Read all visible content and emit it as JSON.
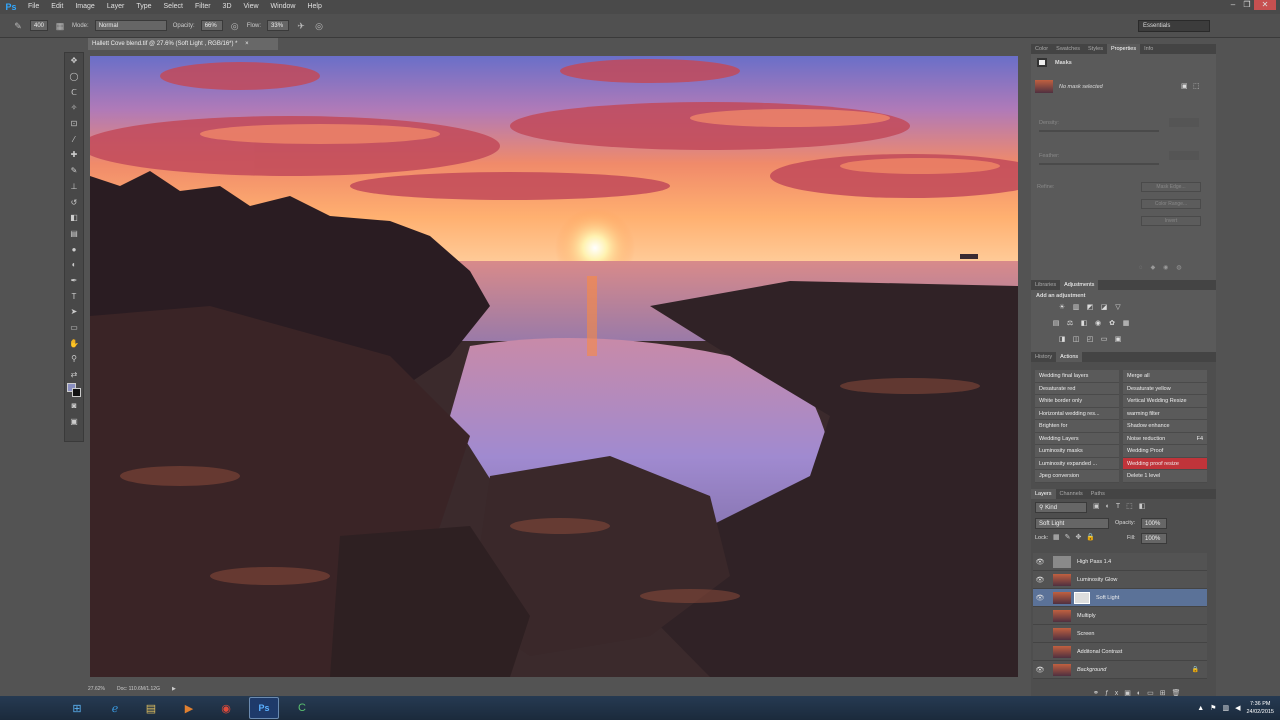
{
  "app": {
    "logo": "Ps"
  },
  "menu": [
    "File",
    "Edit",
    "Image",
    "Layer",
    "Type",
    "Select",
    "Filter",
    "3D",
    "View",
    "Window",
    "Help"
  ],
  "window_controls": {
    "minimize": "–",
    "maximize": "❐",
    "close": "✕"
  },
  "options": {
    "brush_size": "400",
    "mode_label": "Mode:",
    "mode_value": "Normal",
    "opacity_label": "Opacity:",
    "opacity_value": "66%",
    "flow_label": "Flow:",
    "flow_value": "33%"
  },
  "workspace": "Essentials",
  "document": {
    "tab_title": "Hallett Cove blend.tif @ 27.6% (Soft Light , RGB/16*) *",
    "zoom": "27.62%",
    "doc_info": "Doc: 110.6M/1.12G"
  },
  "properties_panel": {
    "tabs": [
      "Color",
      "Swatches",
      "Styles",
      "Properties",
      "Info"
    ],
    "active_tab": "Properties",
    "title": "Masks",
    "status": "No mask selected",
    "density_label": "Density:",
    "feather_label": "Feather:",
    "refine_label": "Refine:",
    "buttons": [
      "Mask Edge...",
      "Color Range...",
      "Invert"
    ]
  },
  "adjustments_panel": {
    "tabs": [
      "Libraries",
      "Adjustments"
    ],
    "active_tab": "Adjustments",
    "title": "Add an adjustment",
    "icons": [
      "brightness-icon",
      "levels-icon",
      "curves-icon",
      "exposure-icon",
      "vibrance-icon",
      "hue-sat-icon",
      "color-balance-icon",
      "bw-icon",
      "photo-filter-icon",
      "channel-mixer-icon",
      "color-lookup-icon",
      "invert-icon",
      "posterize-icon",
      "threshold-icon",
      "gradient-map-icon",
      "selective-color-icon"
    ]
  },
  "actions_panel": {
    "tabs": [
      "History",
      "Actions"
    ],
    "active_tab": "Actions",
    "left": [
      "Wedding final layers",
      "Desaturate red",
      "White border only",
      "Horizontal wedding res...",
      "Brighten for",
      "Wedding Layers",
      "Luminosity masks",
      "Luminosity expanded ...",
      "Jpeg conversion"
    ],
    "right": [
      "Merge all",
      "Desaturate yellow",
      "Vertical Wedding Resize",
      "warming filter",
      "Shadow enhance",
      "Noise reduction",
      "Wedding Proof",
      "Wedding proof resize",
      "Delete 1 level"
    ],
    "shortcut": "F4"
  },
  "layers_panel": {
    "tabs": [
      "Layers",
      "Channels",
      "Paths"
    ],
    "active_tab": "Layers",
    "filter": "Kind",
    "blend_mode": "Soft Light",
    "opacity_label": "Opacity:",
    "opacity_value": "100%",
    "lock_label": "Lock:",
    "fill_label": "Fill:",
    "fill_value": "100%",
    "layers": [
      {
        "name": "High Pass 1.4",
        "visible": true
      },
      {
        "name": "Luminosity Glow",
        "visible": true
      },
      {
        "name": "Soft Light",
        "visible": true,
        "selected": true
      },
      {
        "name": "Multiply",
        "visible": false
      },
      {
        "name": "Screen",
        "visible": false
      },
      {
        "name": "Additonal Contrast",
        "visible": false
      },
      {
        "name": "Background",
        "visible": true
      }
    ]
  },
  "taskbar": {
    "apps": [
      "start-icon",
      "ie-icon",
      "explorer-icon",
      "media-icon",
      "chrome-icon",
      "photoshop-icon",
      "camtasia-icon"
    ],
    "time": "7:36 PM",
    "date": "24/02/2015"
  }
}
